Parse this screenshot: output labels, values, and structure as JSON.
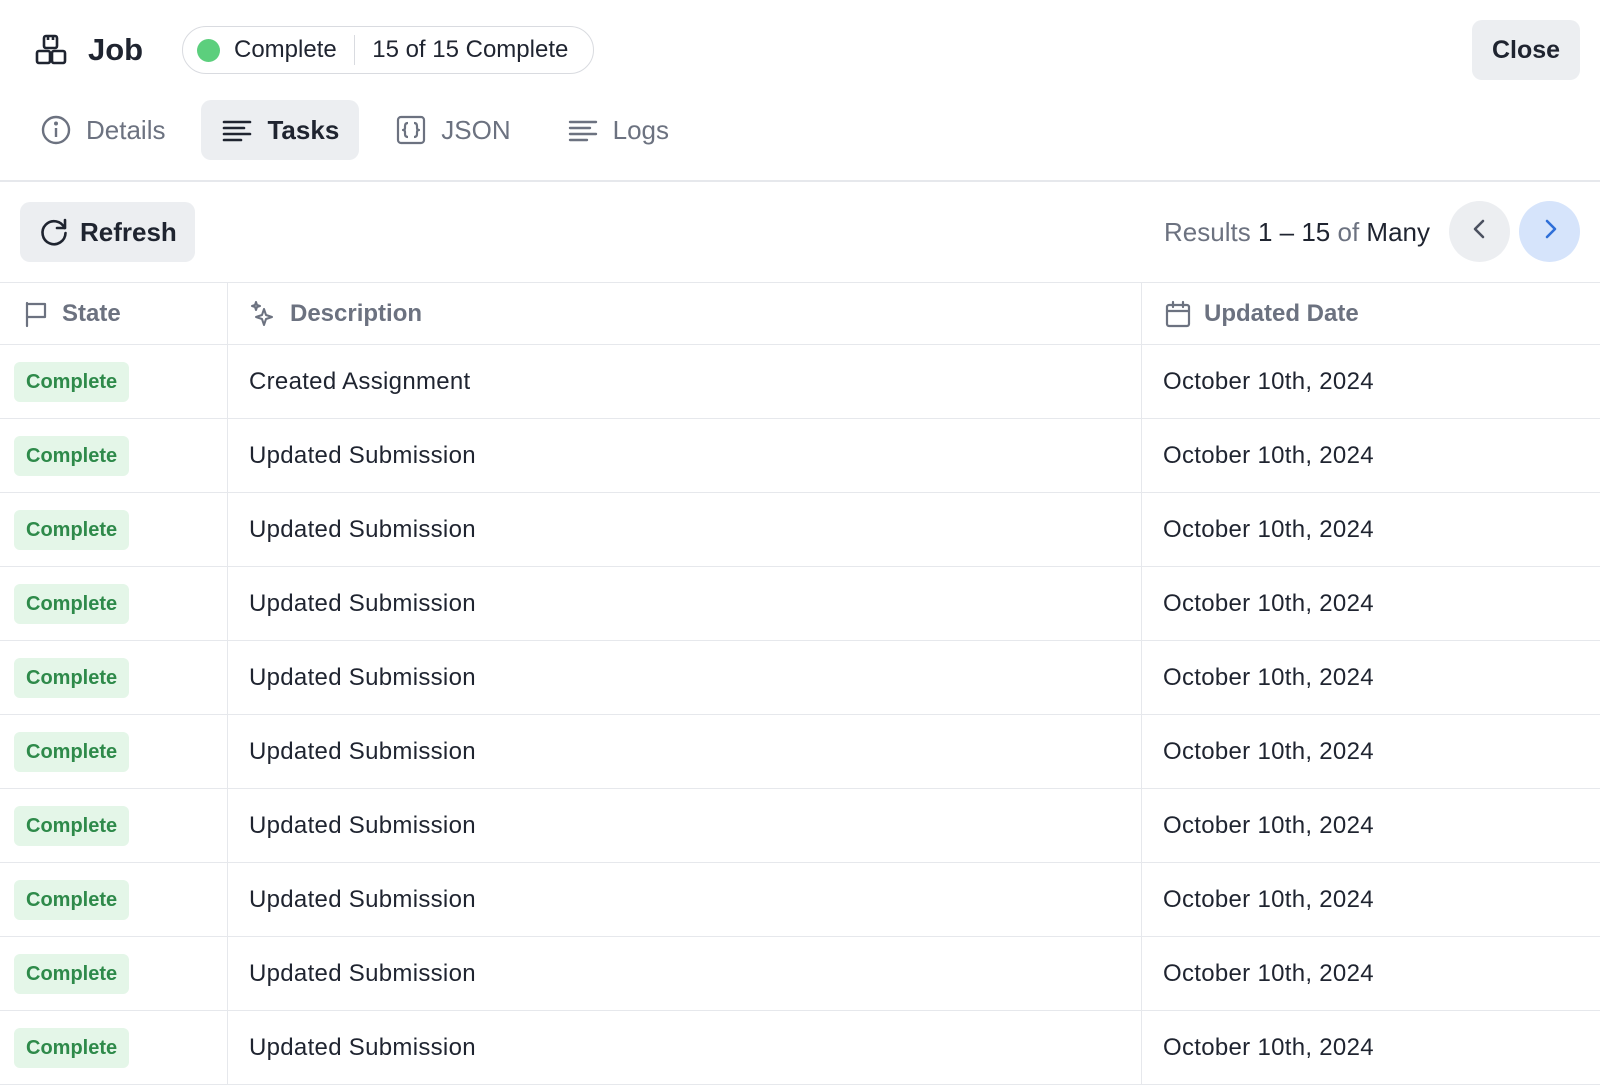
{
  "header": {
    "title": "Job",
    "status": "Complete",
    "status_count": "15 of 15 Complete",
    "status_color": "#5ccf7d",
    "close_label": "Close"
  },
  "tabs": [
    {
      "label": "Details",
      "icon": "info-circle-icon",
      "active": false
    },
    {
      "label": "Tasks",
      "icon": "lines-icon",
      "active": true
    },
    {
      "label": "JSON",
      "icon": "braces-icon",
      "active": false
    },
    {
      "label": "Logs",
      "icon": "lines-icon",
      "active": false
    }
  ],
  "toolbar": {
    "refresh_label": "Refresh",
    "results_prefix": "Results",
    "results_range": "1 – 15",
    "results_of": "of",
    "results_total": "Many"
  },
  "table": {
    "columns": [
      {
        "label": "State",
        "icon": "flag-icon"
      },
      {
        "label": "Description",
        "icon": "sparkle-icon"
      },
      {
        "label": "Updated Date",
        "icon": "calendar-icon"
      }
    ],
    "rows": [
      {
        "state": "Complete",
        "description": "Created Assignment",
        "date": "October 10th, 2024"
      },
      {
        "state": "Complete",
        "description": "Updated Submission",
        "date": "October 10th, 2024"
      },
      {
        "state": "Complete",
        "description": "Updated Submission",
        "date": "October 10th, 2024"
      },
      {
        "state": "Complete",
        "description": "Updated Submission",
        "date": "October 10th, 2024"
      },
      {
        "state": "Complete",
        "description": "Updated Submission",
        "date": "October 10th, 2024"
      },
      {
        "state": "Complete",
        "description": "Updated Submission",
        "date": "October 10th, 2024"
      },
      {
        "state": "Complete",
        "description": "Updated Submission",
        "date": "October 10th, 2024"
      },
      {
        "state": "Complete",
        "description": "Updated Submission",
        "date": "October 10th, 2024"
      },
      {
        "state": "Complete",
        "description": "Updated Submission",
        "date": "October 10th, 2024"
      },
      {
        "state": "Complete",
        "description": "Updated Submission",
        "date": "October 10th, 2024"
      }
    ]
  }
}
